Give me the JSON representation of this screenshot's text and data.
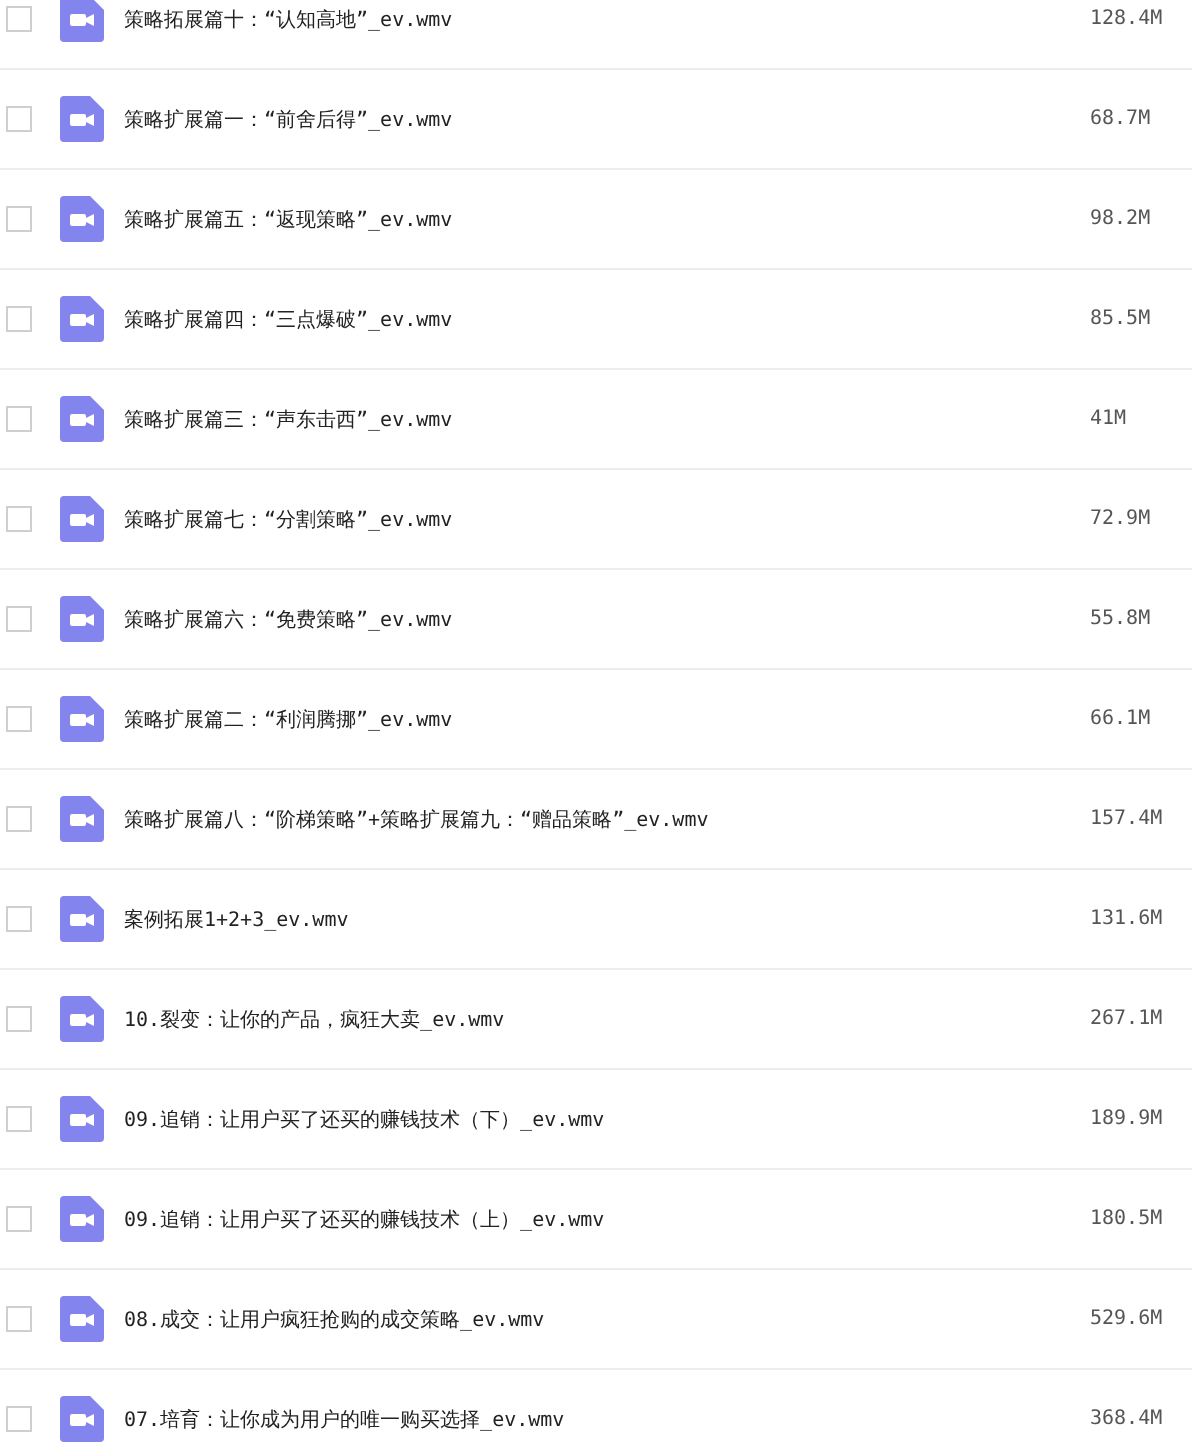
{
  "files": [
    {
      "name": "策略拓展篇十：“认知高地”_ev.wmv",
      "size": "128.4M",
      "checked": false
    },
    {
      "name": "策略扩展篇一：“前舍后得”_ev.wmv",
      "size": "68.7M",
      "checked": false
    },
    {
      "name": "策略扩展篇五：“返现策略”_ev.wmv",
      "size": "98.2M",
      "checked": false
    },
    {
      "name": "策略扩展篇四：“三点爆破”_ev.wmv",
      "size": "85.5M",
      "checked": false
    },
    {
      "name": "策略扩展篇三：“声东击西”_ev.wmv",
      "size": "41M",
      "checked": false
    },
    {
      "name": "策略扩展篇七：“分割策略”_ev.wmv",
      "size": "72.9M",
      "checked": false
    },
    {
      "name": "策略扩展篇六：“免费策略”_ev.wmv",
      "size": "55.8M",
      "checked": false
    },
    {
      "name": "策略扩展篇二：“利润腾挪”_ev.wmv",
      "size": "66.1M",
      "checked": false
    },
    {
      "name": "策略扩展篇八：“阶梯策略”+策略扩展篇九：“赠品策略”_ev.wmv",
      "size": "157.4M",
      "checked": false
    },
    {
      "name": "案例拓展1+2+3_ev.wmv",
      "size": "131.6M",
      "checked": false
    },
    {
      "name": "10.裂变：让你的产品，疯狂大卖_ev.wmv",
      "size": "267.1M",
      "checked": false
    },
    {
      "name": "09.追销：让用户买了还买的赚钱技术（下）_ev.wmv",
      "size": "189.9M",
      "checked": false
    },
    {
      "name": "09.追销：让用户买了还买的赚钱技术（上）_ev.wmv",
      "size": "180.5M",
      "checked": false
    },
    {
      "name": "08.成交：让用户疯狂抢购的成交策略_ev.wmv",
      "size": "529.6M",
      "checked": false
    },
    {
      "name": "07.培育：让你成为用户的唯一购买选择_ev.wmv",
      "size": "368.4M",
      "checked": false
    }
  ]
}
